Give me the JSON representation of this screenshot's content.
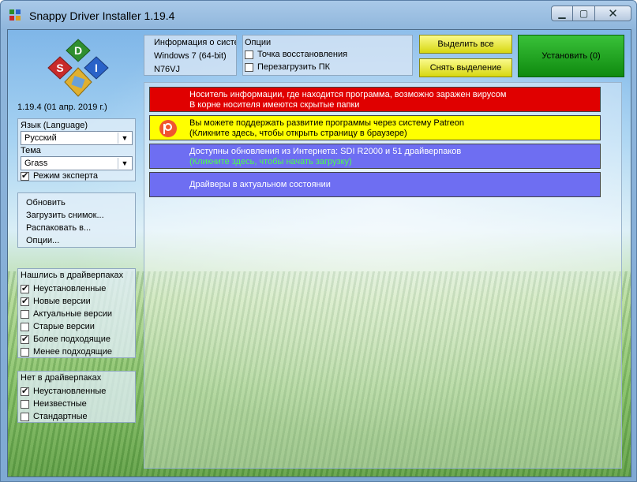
{
  "window": {
    "title": "Snappy Driver Installer 1.19.4"
  },
  "app": {
    "version": "1.19.4 (01 апр. 2019 г.)"
  },
  "language": {
    "label": "Язык (Language)",
    "value": "Русский"
  },
  "theme": {
    "label": "Тема",
    "value": "Grass"
  },
  "expert_mode": {
    "label": "Режим эксперта",
    "checked": true
  },
  "menu": {
    "items": [
      "Обновить",
      "Загрузить снимок...",
      "Распаковать в...",
      "Опции..."
    ]
  },
  "found_in_packs": {
    "title": "Нашлись в драйверпаках",
    "items": [
      {
        "label": "Неустановленные",
        "checked": true
      },
      {
        "label": "Новые версии",
        "checked": true
      },
      {
        "label": "Актуальные версии",
        "checked": false
      },
      {
        "label": "Старые версии",
        "checked": false
      },
      {
        "label": "Более подходящие",
        "checked": true
      },
      {
        "label": "Менее подходящие",
        "checked": false
      }
    ]
  },
  "not_in_packs": {
    "title": "Нет в драйверпаках",
    "items": [
      {
        "label": "Неустановленные",
        "checked": true
      },
      {
        "label": "Неизвестные",
        "checked": false
      },
      {
        "label": "Стандартные",
        "checked": false
      }
    ]
  },
  "sysinfo": {
    "lines": [
      "Информация о систе",
      "Windows 7 (64-bit)",
      "N76VJ"
    ]
  },
  "options": {
    "title": "Опции",
    "items": [
      {
        "label": "Точка восстановления",
        "checked": false
      },
      {
        "label": "Перезагрузить ПК",
        "checked": false
      }
    ]
  },
  "buttons": {
    "select_all": "Выделить все",
    "deselect": "Снять выделение",
    "install": "Установить (0)"
  },
  "messages": [
    {
      "lines": [
        "Носитель информации, где находится программа, возможно заражен вирусом",
        "В корне носителя имеются скрытые папки"
      ]
    },
    {
      "lines": [
        "Вы можете поддержать развитие программы через систему Patreon",
        "(Кликните здесь, чтобы открыть страницу в браузере)"
      ]
    },
    {
      "lines": [
        "Доступны обновления из Интернета: SDI R2000 и 51 драйверпаков",
        "(Кликните здесь, чтобы начать загрузку)"
      ]
    },
    {
      "lines": [
        "Драйверы в актуальном состоянии"
      ]
    }
  ],
  "colors": {
    "red": "#e00000",
    "yellow": "#ffff00",
    "blue": "#6e6ef2",
    "green_link": "#4cff4c",
    "install_green": "#1a9a1a"
  }
}
